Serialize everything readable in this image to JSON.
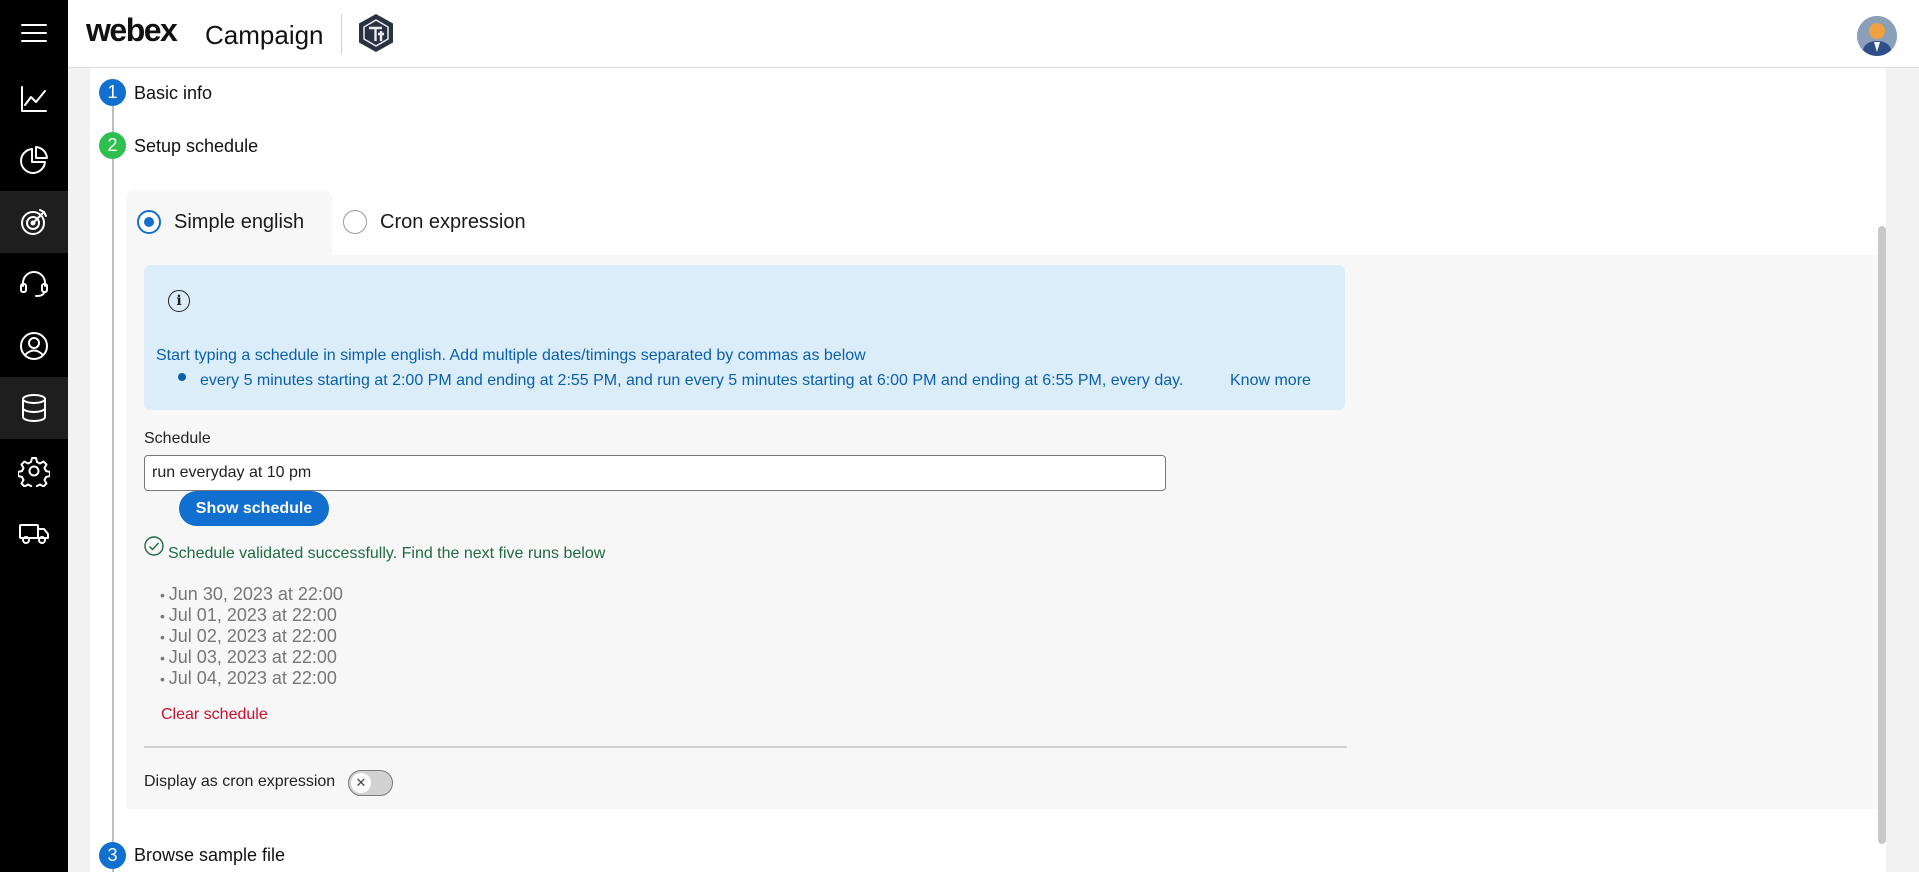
{
  "header": {
    "brand": "webex",
    "product": "Campaign"
  },
  "nav": {
    "items": [
      {
        "name": "menu",
        "icon": "hamburger-menu-icon"
      },
      {
        "name": "analytics",
        "icon": "line-chart-icon"
      },
      {
        "name": "reports",
        "icon": "pie-chart-icon"
      },
      {
        "name": "campaigns",
        "icon": "target-icon",
        "active": true
      },
      {
        "name": "contact-center",
        "icon": "headset-icon"
      },
      {
        "name": "users",
        "icon": "user-icon"
      },
      {
        "name": "data",
        "icon": "database-icon"
      },
      {
        "name": "settings",
        "icon": "gear-icon"
      },
      {
        "name": "delivery",
        "icon": "truck-icon"
      }
    ]
  },
  "steps": [
    {
      "number": "1",
      "label": "Basic info",
      "color": "#1170cf"
    },
    {
      "number": "2",
      "label": "Setup schedule",
      "color": "#2ebf4f"
    },
    {
      "number": "3",
      "label": "Browse sample file",
      "color": "#1170cf"
    }
  ],
  "schedule": {
    "tabs": {
      "simple": "Simple english",
      "cron": "Cron expression"
    },
    "info": {
      "intro": "Start typing a schedule in simple english. Add multiple dates/timings separated by commas as below",
      "example": "every 5 minutes starting at 2:00 PM and ending at 2:55 PM, and run every 5 minutes starting at 6:00 PM and ending at 6:55 PM, every day.",
      "link": "Know more"
    },
    "input_label": "Schedule",
    "input_value": "run everyday at 10 pm",
    "show_button": "Show schedule",
    "validation_message": "Schedule validated successfully. Find the next five runs below",
    "runs": [
      "Jun 30, 2023 at 22:00",
      "Jul 01, 2023 at 22:00",
      "Jul 02, 2023 at 22:00",
      "Jul 03, 2023 at 22:00",
      "Jul 04, 2023 at 22:00"
    ],
    "clear_link": "Clear schedule",
    "cron_toggle_label": "Display as cron expression",
    "cron_toggle_on": false
  },
  "colors": {
    "accent": "#1170cf",
    "success": "#2ebf4f",
    "danger": "#c8102e",
    "info_bg": "#dcedfa"
  }
}
